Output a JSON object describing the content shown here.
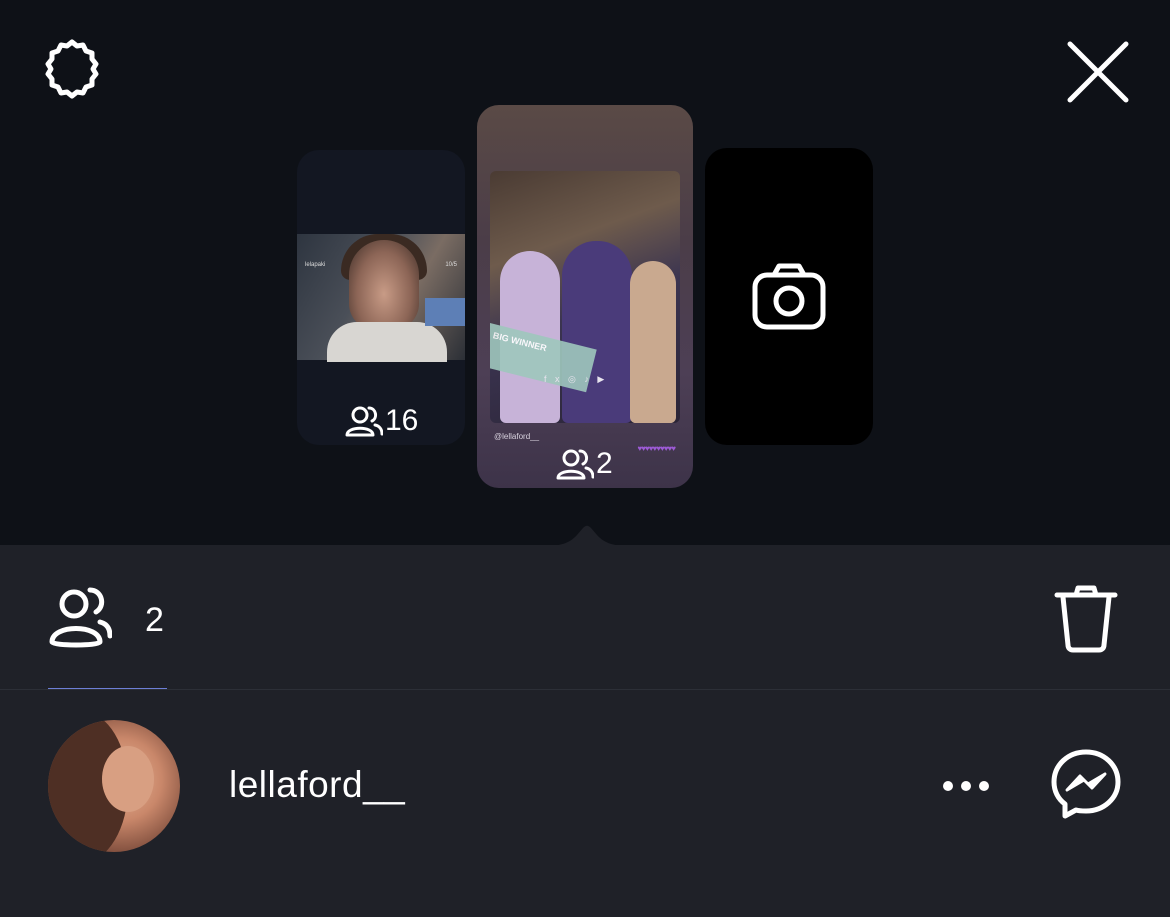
{
  "header": {
    "settings_icon": "settings-gear-icon",
    "close_icon": "close-x-icon"
  },
  "stories": [
    {
      "id": "left",
      "viewers_icon": "viewers-icon",
      "viewer_count": "16",
      "thumb_top_left": "lelapaki",
      "thumb_top_right": "10/5"
    },
    {
      "id": "center",
      "viewers_icon": "viewers-icon",
      "viewer_count": "2",
      "handle": "@lellaford__",
      "thumb_social": "f x ◎ ♪ ▶",
      "thumb_caption": "BIG WINNER",
      "selected": true
    },
    {
      "id": "right",
      "icon": "camera-icon",
      "label": ""
    }
  ],
  "panel": {
    "viewers_tab_count": "2",
    "trash_icon": "trash-icon",
    "viewer_row": {
      "username": "lellaford__",
      "more_icon": "more-horizontal-icon",
      "messenger_icon": "messenger-icon"
    }
  },
  "colors": {
    "background": "#0e1117",
    "panel": "#1f2128",
    "tab_underline": "#6d7fd6",
    "hearts": "#9d5bd6"
  }
}
